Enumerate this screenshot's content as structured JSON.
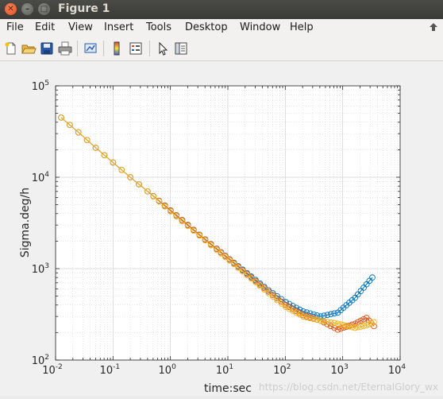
{
  "window": {
    "title": "Figure 1"
  },
  "menu": [
    {
      "label": "File"
    },
    {
      "label": "Edit"
    },
    {
      "label": "View"
    },
    {
      "label": "Insert"
    },
    {
      "label": "Tools"
    },
    {
      "label": "Desktop"
    },
    {
      "label": "Window"
    },
    {
      "label": "Help"
    }
  ],
  "toolbar": {
    "buttons": [
      "new-figure-icon",
      "open-file-icon",
      "save-icon",
      "print-icon",
      "link-plot-icon",
      "insert-colorbar-icon",
      "insert-legend-icon",
      "edit-plot-icon",
      "plot-browser-icon"
    ]
  },
  "watermark": "https://blog.csdn.net/EternalGlory_wx",
  "colors": {
    "series1": "#0072bd",
    "series2": "#d95319",
    "series3": "#edb120",
    "grid": "#d0d0d0"
  },
  "chart_data": {
    "type": "scatter",
    "xlabel": "time:sec",
    "ylabel": "Sigma.deg/h",
    "x_scale": "log",
    "y_scale": "log",
    "xlim": [
      0.01,
      10000
    ],
    "ylim": [
      100,
      100000
    ],
    "x_ticks": [
      {
        "base": "10",
        "exp": "-2"
      },
      {
        "base": "10",
        "exp": "-1"
      },
      {
        "base": "10",
        "exp": "0"
      },
      {
        "base": "10",
        "exp": "1"
      },
      {
        "base": "10",
        "exp": "2"
      },
      {
        "base": "10",
        "exp": "3"
      },
      {
        "base": "10",
        "exp": "4"
      }
    ],
    "y_ticks": [
      {
        "base": "10",
        "exp": "2"
      },
      {
        "base": "10",
        "exp": "3"
      },
      {
        "base": "10",
        "exp": "4"
      },
      {
        "base": "10",
        "exp": "5"
      }
    ],
    "grid": "major and minor",
    "marker": "open circle with connecting line",
    "series": [
      {
        "color": "#0072bd",
        "points": [
          [
            0.0125,
            45000
          ],
          [
            0.025,
            31000
          ],
          [
            0.05,
            21000
          ],
          [
            0.1,
            14500
          ],
          [
            0.2,
            10000
          ],
          [
            0.4,
            7000
          ],
          [
            0.8,
            4900
          ],
          [
            1.6,
            3400
          ],
          [
            3.2,
            2350
          ],
          [
            6.4,
            1650
          ],
          [
            12.8,
            1160
          ],
          [
            25.6,
            820
          ],
          [
            51.2,
            580
          ],
          [
            102,
            430
          ],
          [
            205,
            340
          ],
          [
            410,
            300
          ],
          [
            820,
            330
          ],
          [
            1640,
            480
          ],
          [
            3280,
            800
          ]
        ]
      },
      {
        "color": "#d95319",
        "points": [
          [
            0.0125,
            45000
          ],
          [
            0.025,
            31000
          ],
          [
            0.05,
            21000
          ],
          [
            0.1,
            14500
          ],
          [
            0.2,
            10000
          ],
          [
            0.4,
            7000
          ],
          [
            0.8,
            4900
          ],
          [
            1.6,
            3400
          ],
          [
            3.2,
            2350
          ],
          [
            6.4,
            1650
          ],
          [
            12.8,
            1150
          ],
          [
            25.6,
            800
          ],
          [
            51.2,
            560
          ],
          [
            102,
            400
          ],
          [
            205,
            310
          ],
          [
            410,
            270
          ],
          [
            820,
            215
          ],
          [
            1640,
            250
          ],
          [
            2600,
            290
          ],
          [
            3500,
            235
          ]
        ]
      },
      {
        "color": "#edb120",
        "points": [
          [
            0.0125,
            45000
          ],
          [
            0.025,
            31000
          ],
          [
            0.05,
            21000
          ],
          [
            0.1,
            14500
          ],
          [
            0.2,
            10000
          ],
          [
            0.4,
            7000
          ],
          [
            0.8,
            4800
          ],
          [
            1.6,
            3300
          ],
          [
            3.2,
            2300
          ],
          [
            6.4,
            1600
          ],
          [
            12.8,
            1120
          ],
          [
            25.6,
            780
          ],
          [
            51.2,
            540
          ],
          [
            102,
            380
          ],
          [
            205,
            300
          ],
          [
            410,
            270
          ],
          [
            820,
            250
          ],
          [
            1640,
            225
          ],
          [
            2600,
            240
          ],
          [
            3500,
            260
          ]
        ]
      }
    ]
  }
}
